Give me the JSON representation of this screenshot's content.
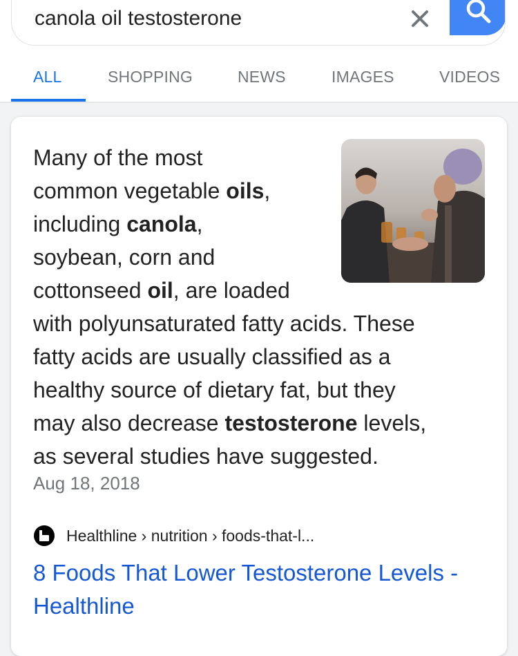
{
  "search": {
    "query": "canola oil testosterone"
  },
  "tabs": [
    {
      "label": "ALL",
      "active": true
    },
    {
      "label": "SHOPPING",
      "active": false
    },
    {
      "label": "NEWS",
      "active": false
    },
    {
      "label": "IMAGES",
      "active": false
    },
    {
      "label": "VIDEOS",
      "active": false
    }
  ],
  "snippet": {
    "p1": "Many of the most",
    "p2": "common vegetable ",
    "b1": "oils",
    "p3": ",",
    "p4": "including ",
    "b2": "canola",
    "p5": ",",
    "p6": "soybean, corn and",
    "p7": "cottonseed ",
    "b3": "oil",
    "p8": ", are loaded",
    "p9": "with polyunsaturated fatty acids. These",
    "p10": "fatty acids are usually classified as a",
    "p11": "healthy source of dietary fat, but they",
    "p12": "may also decrease ",
    "b4": "testosterone",
    "p13": " levels,",
    "p14": "as several studies have suggested.",
    "date": "Aug 18, 2018"
  },
  "result": {
    "site": "Healthline",
    "path": " › nutrition › foods-that-l...",
    "title": "8 Foods That Lower Testosterone Levels - Healthline"
  },
  "colors": {
    "accent": "#1a73e8",
    "search_button": "#4285f4",
    "link": "#1558d6",
    "muted": "#70757a"
  },
  "icons": {
    "clear": "close-icon",
    "search": "search-icon",
    "favicon": "healthline-favicon-icon"
  }
}
